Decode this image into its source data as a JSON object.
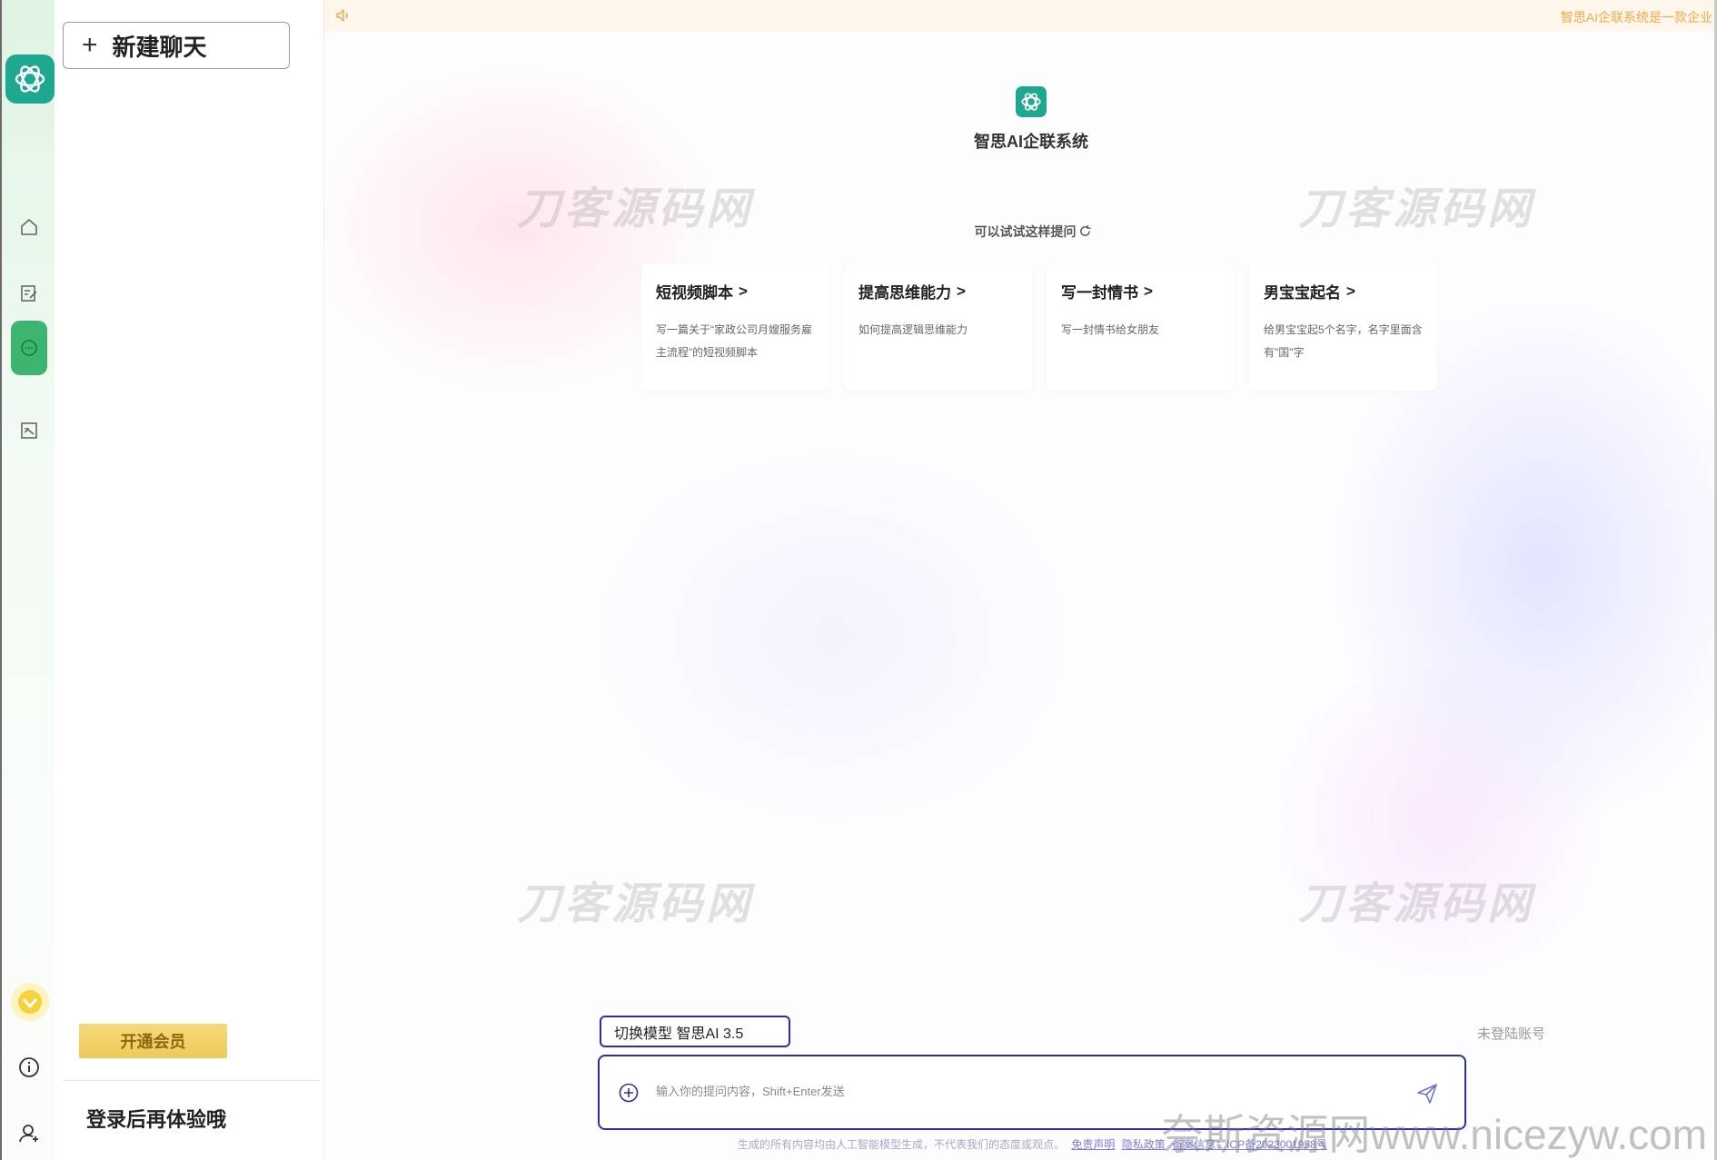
{
  "sidebar": {
    "new_chat_label": "新建聊天",
    "vip_button": "开通会员",
    "login_tip": "登录后再体验哦"
  },
  "notice": {
    "text": "智思AI企联系统是一款企业"
  },
  "brand": {
    "title": "智思AI企联系统",
    "accent_color": "#1fa890"
  },
  "prompts": {
    "heading": "可以试试这样提问",
    "cards": [
      {
        "title": "短视频脚本",
        "desc": "写一篇关于“家政公司月嫂服务雇主流程”的短视频脚本"
      },
      {
        "title": "提高思维能力",
        "desc": "如何提高逻辑思维能力"
      },
      {
        "title": "写一封情书",
        "desc": "写一封情书给女朋友"
      },
      {
        "title": "男宝宝起名",
        "desc": "给男宝宝起5个名字，名字里面含有\"国\"字"
      }
    ]
  },
  "chat": {
    "model_label": "切换模型 智思AI 3.5",
    "account_status": "未登陆账号",
    "input_placeholder": "输入你的提问内容，Shift+Enter发送"
  },
  "footer": {
    "disclaimer": "生成的所有内容均由人工智能模型生成，不代表我们的态度或观点。",
    "links": [
      "免责声明",
      "隐私政策",
      "备案信息：ICP备2023001958号"
    ]
  },
  "watermarks": {
    "center": "刀客源码网",
    "site": "奈斯资源网www.nicezyw.com"
  }
}
